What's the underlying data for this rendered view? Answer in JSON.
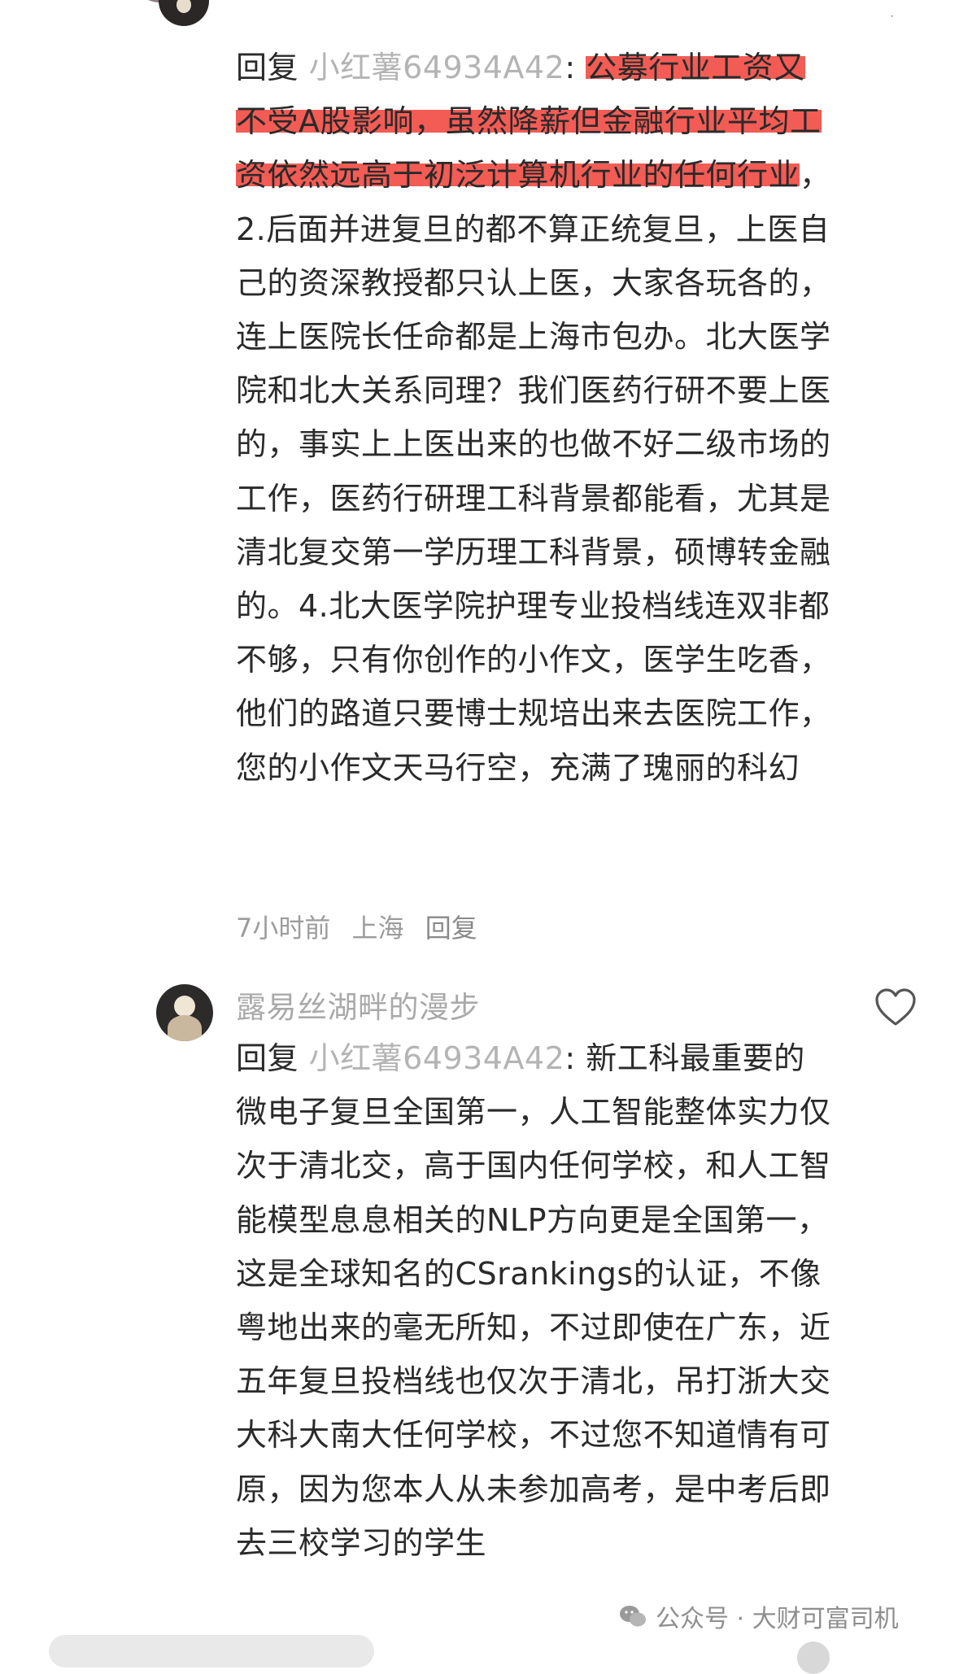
{
  "comment1": {
    "reply_word": "回复",
    "mention": " 小红薯64934A42",
    "colon": ": ",
    "highlighted": "公募行业工资又不受A股影响，虽然降薪但金融行业平均工资依然远高于初泛计算机行业的任何行业",
    "body": "，2.后面并进复旦的都不算正统复旦，上医自己的资深教授都只认上医，大家各玩各的，连上医院长任命都是上海市包办。北大医学院和北大关系同理？我们医药行研不要上医的，事实上上医出来的也做不好二级市场的工作，医药行研理工科背景都能看，尤其是清北复交第一学历理工科背景，硕博转金融的。4.北大医学院护理专业投档线连双非都不够，只有你创作的小作文，医学生吃香，他们的路道只要博士规培出来去医院工作，您的小作文天马行空，充满了瑰丽的科幻",
    "time": "7小时前",
    "location": "上海",
    "reply_action": "回复"
  },
  "comment2": {
    "username": "露易丝湖畔的漫步",
    "reply_word": "回复",
    "mention": " 小红薯64934A42",
    "colon": ": ",
    "body": "新工科最重要的微电子复旦全国第一，人工智能整体实力仅次于清北交，高于国内任何学校，和人工智能模型息息相关的NLP方向更是全国第一，这是全球知名的CSrankings的认证，不像粤地出来的毫无所知，不过即使在广东，近五年复旦投档线也仅次于清北，吊打浙大交大科大南大任何学校，不过您不知道情有可原，因为您本人从未参加高考，是中考后即去三校学习的学生"
  },
  "watermark": {
    "text": "公众号 · 大财可富司机"
  },
  "colors": {
    "highlight": "#f25c55",
    "mention": "#b4b4b4",
    "meta": "#9c9c9c"
  }
}
